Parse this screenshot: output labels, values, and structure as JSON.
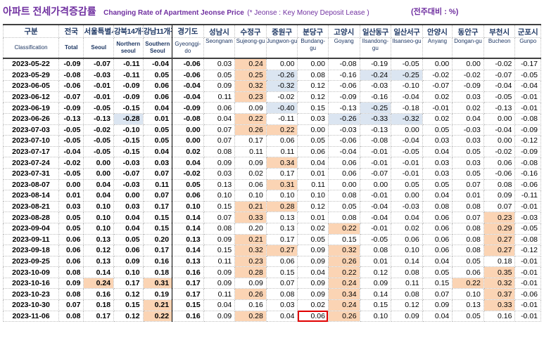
{
  "title": {
    "korean": "아파트 전세가격증감률",
    "english": "Changing Rate of Apartment Jeonse Price",
    "note": "(* Jeonse : Key Money Deposit Lease )",
    "unit": "(전주대비 : %)"
  },
  "columns": [
    {
      "kr": "구분",
      "en": "Classification"
    },
    {
      "kr": "전국",
      "en": "Total"
    },
    {
      "kr": "서울특별시",
      "en": "Seoul"
    },
    {
      "kr": "강북14개구",
      "en": "Northern seoul"
    },
    {
      "kr": "강남11개구",
      "en": "Southern Seoul"
    },
    {
      "kr": "경기도",
      "en": "Gyeonggi-do"
    },
    {
      "kr": "성남시",
      "en": "Seongnam"
    },
    {
      "kr": "수정구",
      "en": "Sujeong-gu"
    },
    {
      "kr": "중원구",
      "en": "Jungwon-gu"
    },
    {
      "kr": "분당구",
      "en": "Bundang-gu"
    },
    {
      "kr": "고양시",
      "en": "Goyang"
    },
    {
      "kr": "일산동구",
      "en": "Ilsandong-gu"
    },
    {
      "kr": "일산서구",
      "en": "Ilsanseo-gu"
    },
    {
      "kr": "안양시",
      "en": "Anyang"
    },
    {
      "kr": "동안구",
      "en": "Dongan-gu"
    },
    {
      "kr": "부천시",
      "en": "Bucheon"
    },
    {
      "kr": "군포시",
      "en": "Gunpo"
    }
  ],
  "rows": [
    {
      "date": "2023-05-22",
      "v": [
        "-0.09",
        "-0.07",
        "-0.11",
        "-0.04",
        "-0.06",
        "0.03",
        "0.24",
        "0.00",
        "0.00",
        "-0.08",
        "-0.19",
        "-0.05",
        "0.00",
        "0.00",
        "-0.02",
        "-0.17"
      ]
    },
    {
      "date": "2023-05-29",
      "v": [
        "-0.08",
        "-0.03",
        "-0.11",
        "0.05",
        "-0.06",
        "0.05",
        "0.25",
        "-0.26",
        "0.08",
        "-0.16",
        "-0.24",
        "-0.25",
        "-0.02",
        "-0.02",
        "-0.07",
        "-0.05"
      ]
    },
    {
      "date": "2023-06-05",
      "v": [
        "-0.06",
        "-0.01",
        "-0.09",
        "0.06",
        "-0.04",
        "0.09",
        "0.32",
        "-0.32",
        "0.12",
        "-0.06",
        "-0.03",
        "-0.10",
        "-0.07",
        "-0.09",
        "-0.04",
        "-0.04"
      ]
    },
    {
      "date": "2023-06-12",
      "v": [
        "-0.07",
        "-0.01",
        "-0.09",
        "0.06",
        "-0.04",
        "0.11",
        "0.23",
        "-0.02",
        "0.12",
        "-0.09",
        "-0.16",
        "-0.04",
        "0.02",
        "0.03",
        "-0.05",
        "-0.01"
      ]
    },
    {
      "date": "2023-06-19",
      "v": [
        "-0.09",
        "-0.05",
        "-0.15",
        "0.04",
        "-0.09",
        "0.06",
        "0.09",
        "-0.40",
        "0.15",
        "-0.13",
        "-0.25",
        "-0.18",
        "-0.01",
        "0.02",
        "-0.13",
        "-0.01"
      ]
    },
    {
      "date": "2023-06-26",
      "v": [
        "-0.13",
        "-0.13",
        "-0.28",
        "0.01",
        "-0.08",
        "0.04",
        "0.22",
        "-0.11",
        "0.03",
        "-0.26",
        "-0.33",
        "-0.32",
        "0.02",
        "0.04",
        "0.00",
        "-0.08"
      ]
    },
    {
      "date": "2023-07-03",
      "v": [
        "-0.05",
        "-0.02",
        "-0.10",
        "0.05",
        "0.00",
        "0.07",
        "0.26",
        "0.22",
        "0.00",
        "-0.03",
        "-0.13",
        "0.00",
        "0.05",
        "-0.03",
        "-0.04",
        "-0.09"
      ]
    },
    {
      "date": "2023-07-10",
      "v": [
        "-0.05",
        "-0.05",
        "-0.15",
        "0.05",
        "0.00",
        "0.07",
        "0.17",
        "0.06",
        "0.05",
        "-0.06",
        "-0.08",
        "-0.04",
        "0.03",
        "0.03",
        "0.00",
        "-0.12"
      ]
    },
    {
      "date": "2023-07-17",
      "v": [
        "-0.04",
        "-0.05",
        "-0.15",
        "0.04",
        "0.02",
        "0.08",
        "0.11",
        "0.11",
        "0.06",
        "-0.04",
        "-0.01",
        "-0.05",
        "0.04",
        "0.05",
        "-0.02",
        "-0.09"
      ]
    },
    {
      "date": "2023-07-24",
      "v": [
        "-0.02",
        "0.00",
        "-0.03",
        "0.03",
        "0.04",
        "0.09",
        "0.09",
        "0.34",
        "0.04",
        "0.06",
        "-0.01",
        "-0.01",
        "0.03",
        "0.03",
        "0.06",
        "-0.08"
      ]
    },
    {
      "date": "2023-07-31",
      "v": [
        "-0.05",
        "0.00",
        "-0.07",
        "0.07",
        "-0.02",
        "0.03",
        "0.02",
        "0.17",
        "0.01",
        "0.06",
        "-0.07",
        "-0.01",
        "0.03",
        "0.05",
        "-0.06",
        "-0.16"
      ]
    },
    {
      "date": "2023-08-07",
      "v": [
        "0.00",
        "0.04",
        "-0.03",
        "0.11",
        "0.05",
        "0.13",
        "0.06",
        "0.31",
        "0.11",
        "0.00",
        "0.00",
        "0.05",
        "0.05",
        "0.07",
        "0.08",
        "-0.06"
      ]
    },
    {
      "date": "2023-08-14",
      "v": [
        "0.01",
        "0.04",
        "0.00",
        "0.07",
        "0.06",
        "0.10",
        "0.10",
        "0.10",
        "0.10",
        "0.08",
        "-0.01",
        "0.00",
        "0.04",
        "0.01",
        "0.09",
        "-0.11"
      ]
    },
    {
      "date": "2023-08-21",
      "v": [
        "0.03",
        "0.10",
        "0.03",
        "0.17",
        "0.10",
        "0.15",
        "0.21",
        "0.28",
        "0.12",
        "0.05",
        "-0.04",
        "-0.03",
        "0.08",
        "0.08",
        "0.07",
        "-0.01"
      ]
    },
    {
      "date": "2023-08-28",
      "v": [
        "0.05",
        "0.10",
        "0.04",
        "0.15",
        "0.14",
        "0.07",
        "0.33",
        "0.13",
        "0.01",
        "0.08",
        "-0.04",
        "0.04",
        "0.06",
        "0.07",
        "0.23",
        "-0.03"
      ]
    },
    {
      "date": "2023-09-04",
      "v": [
        "0.05",
        "0.10",
        "0.04",
        "0.15",
        "0.14",
        "0.08",
        "0.20",
        "0.13",
        "0.02",
        "0.22",
        "-0.01",
        "0.02",
        "0.06",
        "0.08",
        "0.29",
        "-0.05"
      ]
    },
    {
      "date": "2023-09-11",
      "v": [
        "0.06",
        "0.13",
        "0.05",
        "0.20",
        "0.13",
        "0.09",
        "0.21",
        "0.17",
        "0.05",
        "0.15",
        "-0.05",
        "0.06",
        "0.06",
        "0.08",
        "0.27",
        "-0.08"
      ]
    },
    {
      "date": "2023-09-18",
      "v": [
        "0.06",
        "0.12",
        "0.06",
        "0.17",
        "0.14",
        "0.15",
        "0.32",
        "0.27",
        "0.09",
        "0.32",
        "0.08",
        "0.10",
        "0.06",
        "0.08",
        "0.27",
        "-0.12"
      ]
    },
    {
      "date": "2023-09-25",
      "v": [
        "0.06",
        "0.13",
        "0.09",
        "0.16",
        "0.13",
        "0.11",
        "0.23",
        "0.06",
        "0.09",
        "0.26",
        "0.01",
        "0.14",
        "0.04",
        "0.05",
        "0.18",
        "-0.01"
      ]
    },
    {
      "date": "2023-10-09",
      "v": [
        "0.08",
        "0.14",
        "0.10",
        "0.18",
        "0.16",
        "0.09",
        "0.28",
        "0.15",
        "0.04",
        "0.22",
        "0.12",
        "0.08",
        "0.05",
        "0.06",
        "0.35",
        "-0.01"
      ]
    },
    {
      "date": "2023-10-16",
      "v": [
        "0.09",
        "0.24",
        "0.17",
        "0.31",
        "0.17",
        "0.09",
        "0.09",
        "0.07",
        "0.09",
        "0.24",
        "0.09",
        "0.11",
        "0.15",
        "0.22",
        "0.32",
        "-0.01"
      ]
    },
    {
      "date": "2023-10-23",
      "v": [
        "0.08",
        "0.16",
        "0.12",
        "0.19",
        "0.17",
        "0.11",
        "0.26",
        "0.08",
        "0.09",
        "0.34",
        "0.14",
        "0.08",
        "0.07",
        "0.10",
        "0.37",
        "-0.06"
      ]
    },
    {
      "date": "2023-10-30",
      "v": [
        "0.07",
        "0.18",
        "0.15",
        "0.21",
        "0.15",
        "0.04",
        "0.16",
        "0.03",
        "0.02",
        "0.24",
        "0.15",
        "0.12",
        "0.09",
        "0.13",
        "0.33",
        "-0.01"
      ]
    },
    {
      "date": "2023-11-06",
      "v": [
        "0.08",
        "0.17",
        "0.12",
        "0.22",
        "0.16",
        "0.09",
        "0.28",
        "0.04",
        "0.06",
        "0.26",
        "0.10",
        "0.09",
        "0.04",
        "0.05",
        "0.16",
        "-0.01"
      ]
    }
  ],
  "highlight_colors": {
    "positive": "#fbd4b4",
    "negative": "#dbe5f1",
    "box": "#e00000"
  },
  "boxed_cell": {
    "row": "2023-11-06",
    "column": "Bundang-gu"
  }
}
